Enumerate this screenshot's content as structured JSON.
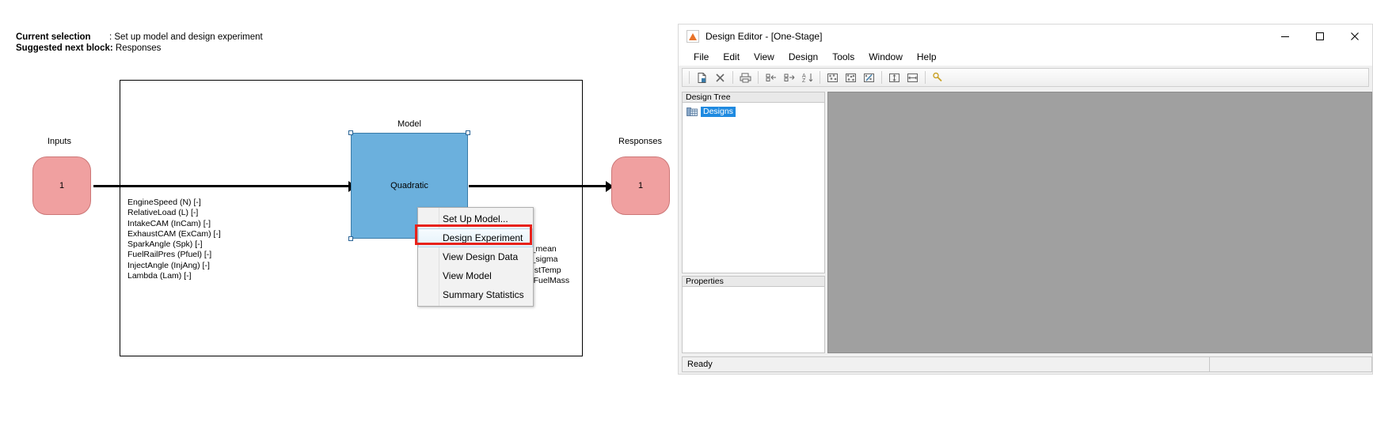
{
  "browser": {
    "current_selection_label": "Current selection",
    "current_selection_value": ": Set up model and design experiment",
    "suggested_next_label": "Suggested next block:",
    "suggested_next_value": "Responses",
    "inputs_label": "Inputs",
    "responses_label": "Responses",
    "model_label": "Model",
    "model_type": "Quadratic",
    "input_port_count": "1",
    "response_port_count": "1",
    "inputs": [
      "EngineSpeed (N) [-]",
      "RelativeLoad (L) [-]",
      "IntakeCAM (InCam) [-]",
      "ExhaustCAM (ExCam) [-]",
      "SparkAngle (Spk) [-]",
      "FuelRailPres (Pfuel) [-]",
      "InjectAngle (InjAng) [-]",
      "Lambda (Lam) [-]"
    ],
    "responses": [
      "IMEP_mean",
      "IMEP_sigma",
      "ExhaustTemp",
      "IntakeFuelMass"
    ]
  },
  "context_menu": {
    "items": [
      {
        "label": "Set Up Model...",
        "highlighted": false
      },
      {
        "label": "Design Experiment",
        "highlighted": true
      },
      {
        "label": "View Design Data",
        "highlighted": false
      },
      {
        "label": "View Model",
        "highlighted": false
      },
      {
        "label": "Summary Statistics",
        "highlighted": false
      }
    ],
    "highlight_color": "#e8211a"
  },
  "design_editor": {
    "title": "Design Editor - [One-Stage]",
    "menus": [
      "File",
      "Edit",
      "View",
      "Design",
      "Tools",
      "Window",
      "Help"
    ],
    "window_buttons": [
      "minimize",
      "maximize",
      "close"
    ],
    "toolbar_icons": [
      "new-design-icon",
      "delete-icon",
      "print-icon",
      "move-left-icon",
      "move-right-icon",
      "sort-icon",
      "design-points-icon",
      "design-points-alt-icon",
      "design-edit-icon",
      "fit-vertical-icon",
      "fit-horizontal-icon",
      "help-icon"
    ],
    "design_tree": {
      "header": "Design Tree",
      "selected_node": "Designs"
    },
    "properties": {
      "header": "Properties"
    },
    "status": {
      "text": "Ready"
    }
  }
}
